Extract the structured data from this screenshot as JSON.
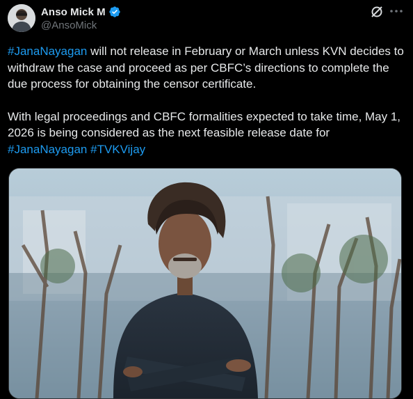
{
  "author": {
    "display_name": "Anso Mick M",
    "handle": "@AnsoMick",
    "verified": true,
    "verified_icon": "verified-badge-icon",
    "avatar_icon": "avatar"
  },
  "actions": {
    "grok_icon": "grok-icon",
    "more_icon": "more-options-icon"
  },
  "tweet": {
    "paragraph1": {
      "hashtag": "#JanaNayagan",
      "text": " will not release in February or March unless KVN decides to withdraw the case and proceed as per CBFC’s directions to complete the due process for obtaining the censor certificate."
    },
    "paragraph2": {
      "text": "With legal proceedings and CBFC formalities expected to take time, May 1, 2026 is being considered as the next feasible release date for ",
      "hashtag1": "#JanaNayagan",
      "hashtag2": "#TVKVijay"
    }
  },
  "media": {
    "description_icon": "photo-man-with-crossed-arms"
  },
  "colors": {
    "background": "#000000",
    "text": "#e7e9ea",
    "secondary": "#71767b",
    "link": "#1d9bf0",
    "verified": "#1d9bf0"
  }
}
